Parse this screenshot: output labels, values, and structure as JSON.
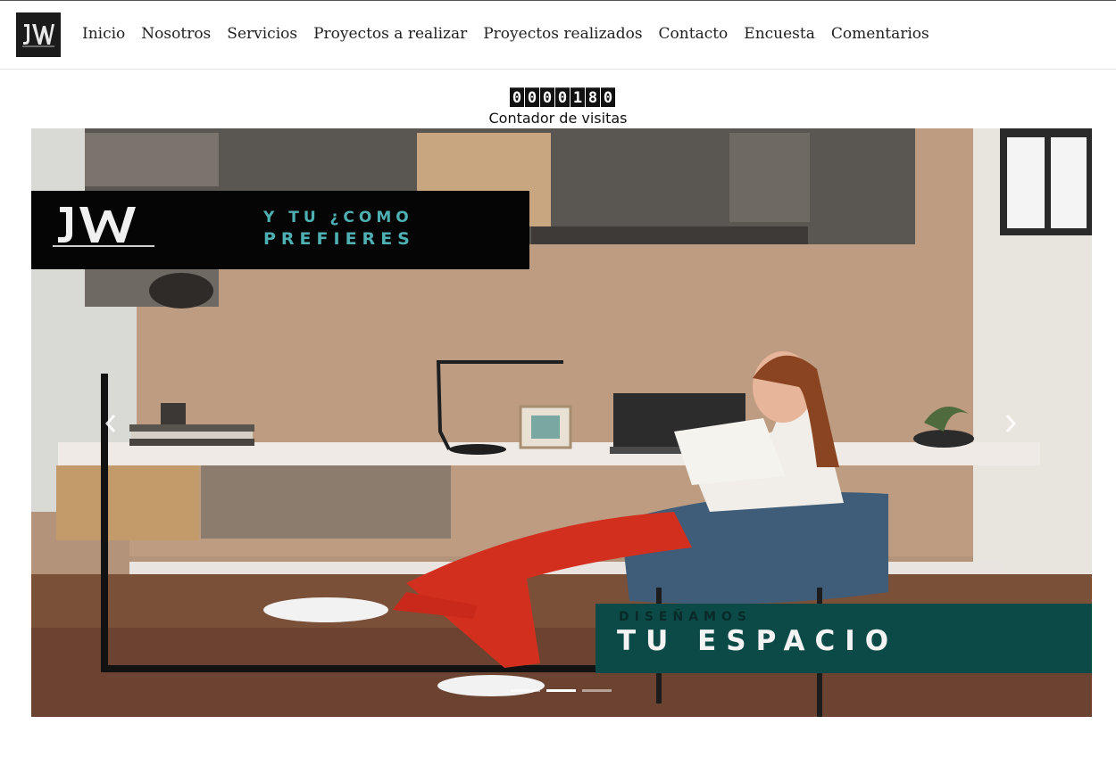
{
  "nav": {
    "logo_text": "JW",
    "links": [
      {
        "label": "Inicio"
      },
      {
        "label": "Nosotros"
      },
      {
        "label": "Servicios"
      },
      {
        "label": "Proyectos a realizar"
      },
      {
        "label": "Proyectos realizados"
      },
      {
        "label": "Contacto"
      },
      {
        "label": "Encuesta"
      },
      {
        "label": "Comentarios"
      }
    ]
  },
  "counter": {
    "digits": [
      "0",
      "0",
      "0",
      "0",
      "1",
      "8",
      "0"
    ],
    "label": "Contador de visitas"
  },
  "carousel": {
    "slide": {
      "logo_text": "JW",
      "top_line1": "Y TU ¿COMO",
      "top_line2": "PREFIERES",
      "bottom_sub": "DISEÑAMOS",
      "bottom_main": "TU ESPACIO"
    },
    "prev_icon": "chevron-left-icon",
    "next_icon": "chevron-right-icon",
    "indicators": 3,
    "active_index": 1
  },
  "colors": {
    "teal_banner": "#0c4a48",
    "teal_text": "#4fb0b3",
    "black_banner": "#050505"
  }
}
